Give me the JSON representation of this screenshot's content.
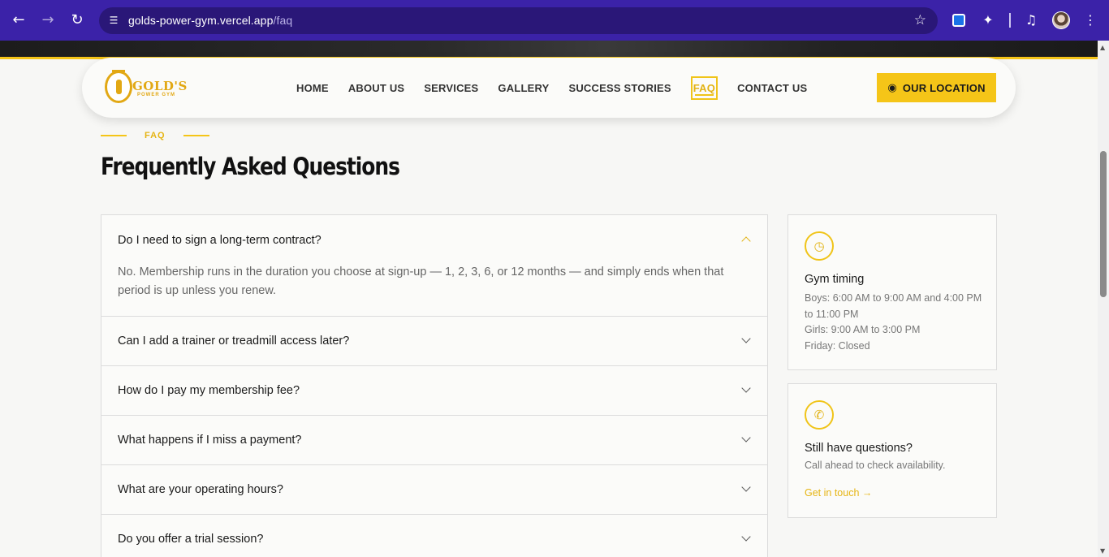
{
  "browser": {
    "url_host": "golds-power-gym.vercel.app",
    "url_path": "/faq",
    "icons": {
      "back": "arrow-left-icon",
      "forward": "arrow-right-icon",
      "reload": "reload-icon",
      "site_info": "tune-icon",
      "bookmark": "star-icon",
      "extensions": "puzzle-icon",
      "media": "media-icon",
      "menu": "kebab-icon"
    }
  },
  "header": {
    "logo_word": "GOLD'S",
    "logo_sub": "POWER GYM",
    "nav": [
      {
        "label": "HOME"
      },
      {
        "label": "ABOUT US"
      },
      {
        "label": "SERVICES"
      },
      {
        "label": "GALLERY"
      },
      {
        "label": "SUCCESS STORIES"
      },
      {
        "label": "FAQ",
        "active": true
      },
      {
        "label": "CONTACT US"
      }
    ],
    "location_button": "OUR LOCATION"
  },
  "section": {
    "eyebrow": "FAQ",
    "title": "Frequently Asked Questions"
  },
  "faq": [
    {
      "question": "Do I need to sign a long-term contract?",
      "answer": "No. Membership runs in the duration you choose at sign-up — 1, 2, 3, 6, or 12 months — and simply ends when that period is up unless you renew.",
      "open": true
    },
    {
      "question": "Can I add a trainer or treadmill access later?"
    },
    {
      "question": "How do I pay my membership fee?"
    },
    {
      "question": "What happens if I miss a payment?"
    },
    {
      "question": "What are your operating hours?"
    },
    {
      "question": "Do you offer a trial session?"
    }
  ],
  "timing_card": {
    "icon": "clock-icon",
    "title": "Gym timing",
    "lines": [
      "Boys: 6:00 AM to 9:00 AM and 4:00 PM to 11:00 PM",
      "Girls: 9:00 AM to 3:00 PM",
      "Friday: Closed"
    ]
  },
  "questions_card": {
    "icon": "phone-icon",
    "title": "Still have questions?",
    "text": "Call ahead to check availability.",
    "link": "Get in touch →"
  },
  "colors": {
    "accent": "#f5c518",
    "chrome": "#3b22a8"
  }
}
